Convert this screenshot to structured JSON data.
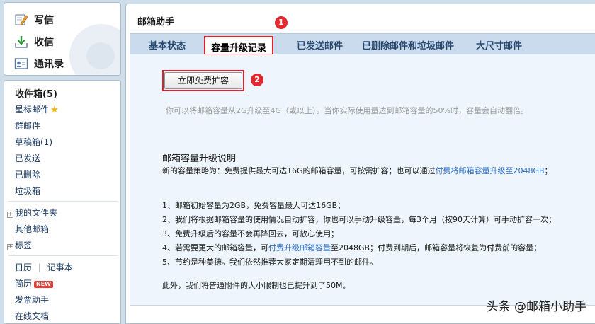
{
  "quick_actions": {
    "compose": "写信",
    "inbox": "收信",
    "contacts": "通讯录"
  },
  "nav": {
    "inbox": "收件箱(5)",
    "starred": "星标邮件",
    "group": "群邮件",
    "drafts": "草稿箱(1)",
    "sent": "已发送",
    "deleted": "已删除",
    "trash": "垃圾箱",
    "my_folders": "我的文件夹",
    "other_mail": "其他邮箱",
    "tags": "标签",
    "calendar": "日历",
    "notes": "记事本",
    "divider": "|",
    "resume": "简历",
    "new_badge": "NEW",
    "invoice": "发票助手",
    "online_docs": "在线文档"
  },
  "main": {
    "title": "邮箱助手",
    "tabs": [
      "基本状态",
      "容量升级记录",
      "已发送邮件",
      "已删除邮件和垃圾邮件",
      "大尺寸邮件"
    ],
    "active_tab": 1,
    "badge1": "1",
    "badge2": "2",
    "upgrade_button": "立即免费扩容",
    "hint": "你可以将邮箱容量从2G升级至4G（或以上）。当你实际使用量达到邮箱容量的50%时，容量会自动翻倍。",
    "section_title": "邮箱容量升级说明",
    "policy_pre": "新的容量策略为：免费提供最大可达16G的邮箱容量，可按需扩容；也可以通过",
    "policy_link": "付费将邮箱容量升级至2048GB",
    "policy_post": "；",
    "item1": "1、邮箱初始容量为2GB，免费容量最大可达16GB；",
    "item2": "2、我们将根据邮箱容量的使用情况自动扩容，你也可以手动升级容量，每3个月（按90天计算）可手动扩容一次；",
    "item3": "3、免费升级后的容量不会再降回去，可放心使用；",
    "item4_pre": "4、若需要更大的邮箱容量，可",
    "item4_link": "付费升级邮箱容量",
    "item4_post": "至2048GB；付费到期后，邮箱容量将恢复为付费前的容量；",
    "item5": "5、节约是种美德。我们依然推荐大家定期清理用不到的邮件。",
    "footer": "此外，我们将普通附件的大小限制也已提升到了50M。"
  },
  "watermark": "头条 @邮箱小助手",
  "colors": {
    "accent_red": "#d9232a",
    "link_blue": "#2b6cc4",
    "tab_bar": "#c9dbec",
    "content_bg": "#eef5fc"
  }
}
